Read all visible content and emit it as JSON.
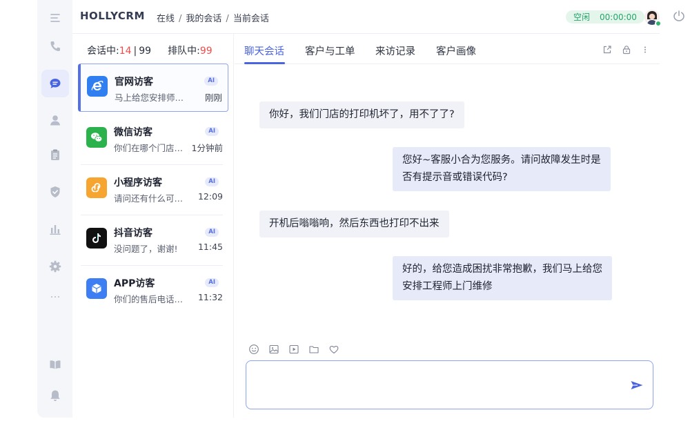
{
  "header": {
    "logo": "HOLLYCRM",
    "breadcrumb": [
      "在线",
      "我的会话",
      "当前会话"
    ],
    "status_label": "空闲",
    "status_timer": "00:00:00"
  },
  "sidebar": {
    "items": [
      {
        "icon": "menu-icon"
      },
      {
        "icon": "phone-icon"
      },
      {
        "icon": "chat-icon",
        "active": true
      },
      {
        "icon": "user-icon"
      },
      {
        "icon": "clipboard-icon"
      },
      {
        "icon": "shield-icon"
      },
      {
        "icon": "bar-chart-icon"
      },
      {
        "icon": "gear-icon"
      },
      {
        "icon": "more-icon"
      },
      {
        "icon": "book-icon"
      },
      {
        "icon": "bell-icon"
      }
    ]
  },
  "conversations": {
    "in_session_label": "会话中:",
    "in_session_count": "14",
    "in_session_total": "99",
    "queue_label": "排队中:",
    "queue_count": "99",
    "items": [
      {
        "title": "官网访客",
        "preview": "马上给您安排师…",
        "time": "刚刚",
        "badge": "AI",
        "icon": "ie-browser-icon",
        "color": "#2f7ff0"
      },
      {
        "title": "微信访客",
        "preview": "你们在哪个门店…",
        "time": "1分钟前",
        "badge": "AI",
        "icon": "wechat-icon",
        "color": "#2bb24c"
      },
      {
        "title": "小程序访客",
        "preview": "请问还有什么可…",
        "time": "12:09",
        "badge": "AI",
        "icon": "mini-program-icon",
        "color": "#f7a531"
      },
      {
        "title": "抖音访客",
        "preview": "没问题了，谢谢!",
        "time": "11:45",
        "badge": "AI",
        "icon": "tiktok-icon",
        "color": "#111111"
      },
      {
        "title": "APP访客",
        "preview": "你们的售后电话…",
        "time": "11:32",
        "badge": "AI",
        "icon": "app-cube-icon",
        "color": "#3d7ef2"
      }
    ]
  },
  "chat": {
    "tabs": [
      "聊天会话",
      "客户与工单",
      "来访记录",
      "客户画像"
    ],
    "active_tab": 0,
    "messages": [
      {
        "side": "in",
        "lines": [
          "你好，我们门店的打印机坏了，用不了了?"
        ]
      },
      {
        "side": "out",
        "lines": [
          "您好~客服小合为您服务。请问故障发生时是",
          "否有提示音或错误代码?"
        ]
      },
      {
        "side": "in",
        "lines": [
          "开机后嗡嗡响，然后东西也打印不出来"
        ]
      },
      {
        "side": "out",
        "lines": [
          "好的，给您造成困扰非常抱歉，我们马上给您",
          "安排工程师上门维修"
        ]
      }
    ],
    "input_value": ""
  },
  "colors": {
    "accent": "#4a63e0",
    "status_green": "#27a36a",
    "badge_red": "#ef4b4b"
  }
}
